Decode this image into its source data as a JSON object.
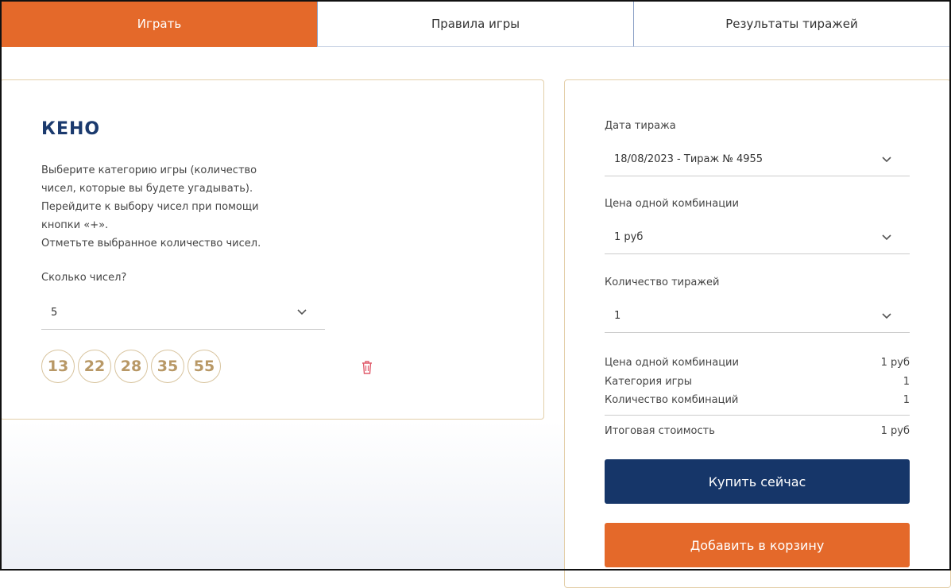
{
  "tabs": [
    {
      "label": "Играть",
      "active": true
    },
    {
      "label": "Правила игры",
      "active": false
    },
    {
      "label": "Результаты тиражей",
      "active": false
    }
  ],
  "game": {
    "title": "КЕНО",
    "instructions": [
      "Выберите категорию игры (количество",
      "чисел, которые вы будете угадывать).",
      "Перейдите к выбору чисел при помощи",
      "кнопки «+».",
      "Отметьте выбранное количество чисел."
    ],
    "count_label": "Сколько чисел?",
    "count_value": "5",
    "numbers": [
      "13",
      "22",
      "28",
      "35",
      "55"
    ],
    "delete_icon": "trash-icon"
  },
  "order": {
    "draw_date_label": "Дата тиража",
    "draw_date_value": "18/08/2023 - Тираж № 4955",
    "price_label": "Цена одной комбинации",
    "price_value": "1 руб",
    "draws_label": "Количество тиражей",
    "draws_value": "1",
    "summary": [
      {
        "label": "Цена одной комбинации",
        "value": "1 руб"
      },
      {
        "label": "Категория игры",
        "value": "1"
      },
      {
        "label": "Количество комбинаций",
        "value": "1"
      }
    ],
    "total_label": "Итоговая стоимость",
    "total_value": "1 руб",
    "buy_label": "Купить сейчас",
    "cart_label": "Добавить в корзину"
  },
  "colors": {
    "accent_orange": "#e4692a",
    "primary_navy": "#163669",
    "ball_gold": "#b89866"
  }
}
